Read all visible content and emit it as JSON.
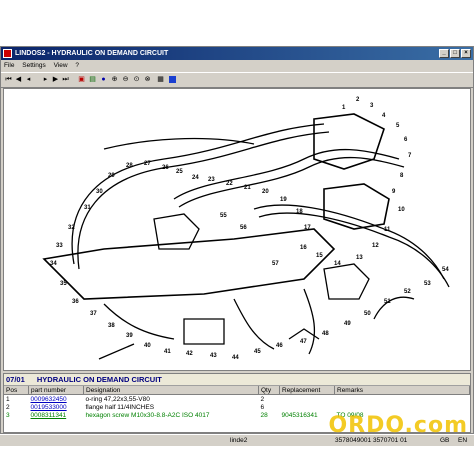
{
  "window": {
    "title": "LINDOS2 - HYDRAULIC ON DEMAND CIRCUIT"
  },
  "menu": [
    "File",
    "Settings",
    "View",
    "?"
  ],
  "drawing": {
    "callouts": [
      "1",
      "2",
      "3",
      "4",
      "5",
      "6",
      "7",
      "8",
      "9",
      "10",
      "11",
      "12",
      "13",
      "14",
      "15",
      "16",
      "17",
      "18",
      "19",
      "20",
      "21",
      "22",
      "23",
      "24",
      "25",
      "26",
      "27",
      "28",
      "29",
      "30",
      "31",
      "32",
      "33",
      "34",
      "35",
      "36",
      "37",
      "38",
      "39",
      "40",
      "41",
      "42",
      "43",
      "44",
      "45",
      "46",
      "47",
      "48",
      "49",
      "50",
      "51",
      "52",
      "53",
      "54",
      "55",
      "56",
      "57"
    ]
  },
  "panel": {
    "section": "07/01",
    "heading": "HYDRAULIC ON DEMAND CIRCUIT",
    "columns": [
      "Pos",
      "part number",
      "Designation",
      "Qty",
      "Replacement",
      "Remarks"
    ],
    "rows": [
      {
        "pos": "1",
        "part": "0009632450",
        "designation": "o-ring  47,22x3,55-V80",
        "qty": "2",
        "replacement": "",
        "remarks": ""
      },
      {
        "pos": "2",
        "part": "0019533000",
        "designation": "flange half 11/4INCHES",
        "qty": "6",
        "replacement": "",
        "remarks": ""
      },
      {
        "pos": "3",
        "part": "0008311341",
        "designation": "hexagon screw  M10x30-8.8-A2C ISO 4017",
        "qty": "28",
        "replacement": "9045316341",
        "remarks": "TO 09/08"
      }
    ]
  },
  "status": {
    "left": "linde2",
    "mid": "3578049001  3570701 01",
    "right1": "GB",
    "right2": "EN"
  },
  "watermark": "ORDO.com"
}
